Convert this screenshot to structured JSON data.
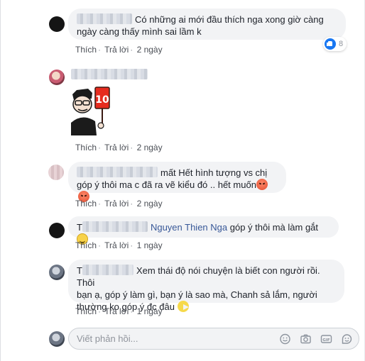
{
  "comments": [
    {
      "text": "Có những ai mới đầu thích nga xong giờ càng\nngày càng thấy mình sai lầm k",
      "like_label": "Thích",
      "reply_label": "Trả lời",
      "time": "2 ngày",
      "reaction_count": "8"
    },
    {
      "sticker_text": "10",
      "like_label": "Thích",
      "reply_label": "Trả lời",
      "time": "2 ngày"
    },
    {
      "text_line1": "mất Hết hình tượng vs chị",
      "text_line2": "góp ý thôi ma c đã ra vẽ kiểu đó .. hết muốn",
      "like_label": "Thích",
      "reply_label": "Trả lời",
      "time": "2 ngày"
    },
    {
      "mention_prefix": "T",
      "mention": "Nguyen Thien Nga",
      "text": " góp ý thôi mà làm gắt",
      "like_label": "Thích",
      "reply_label": "Trả lời",
      "time": "1 ngày"
    },
    {
      "mention_prefix": "T",
      "text_line1": "Xem thái độ nói chuyện là biết con người rồi. Thôi",
      "text_line2": "bạn ạ, góp ý làm gì, bạn ý là sao mà, Chanh sả lắm, người",
      "text_line3": "thường ko góp ý đc đâu",
      "like_label": "Thích",
      "reply_label": "Trả lời",
      "time": "1 ngày"
    }
  ],
  "reply_box": {
    "placeholder": "Viết phản hồi..."
  },
  "colors": {
    "bubble": "#f2f3f5",
    "link": "#385898",
    "like_blue": "#1877f2",
    "sticker_red": "#e62c1f"
  },
  "icons": [
    "smiley-icon",
    "camera-icon",
    "gif-icon",
    "sticker-icon"
  ]
}
